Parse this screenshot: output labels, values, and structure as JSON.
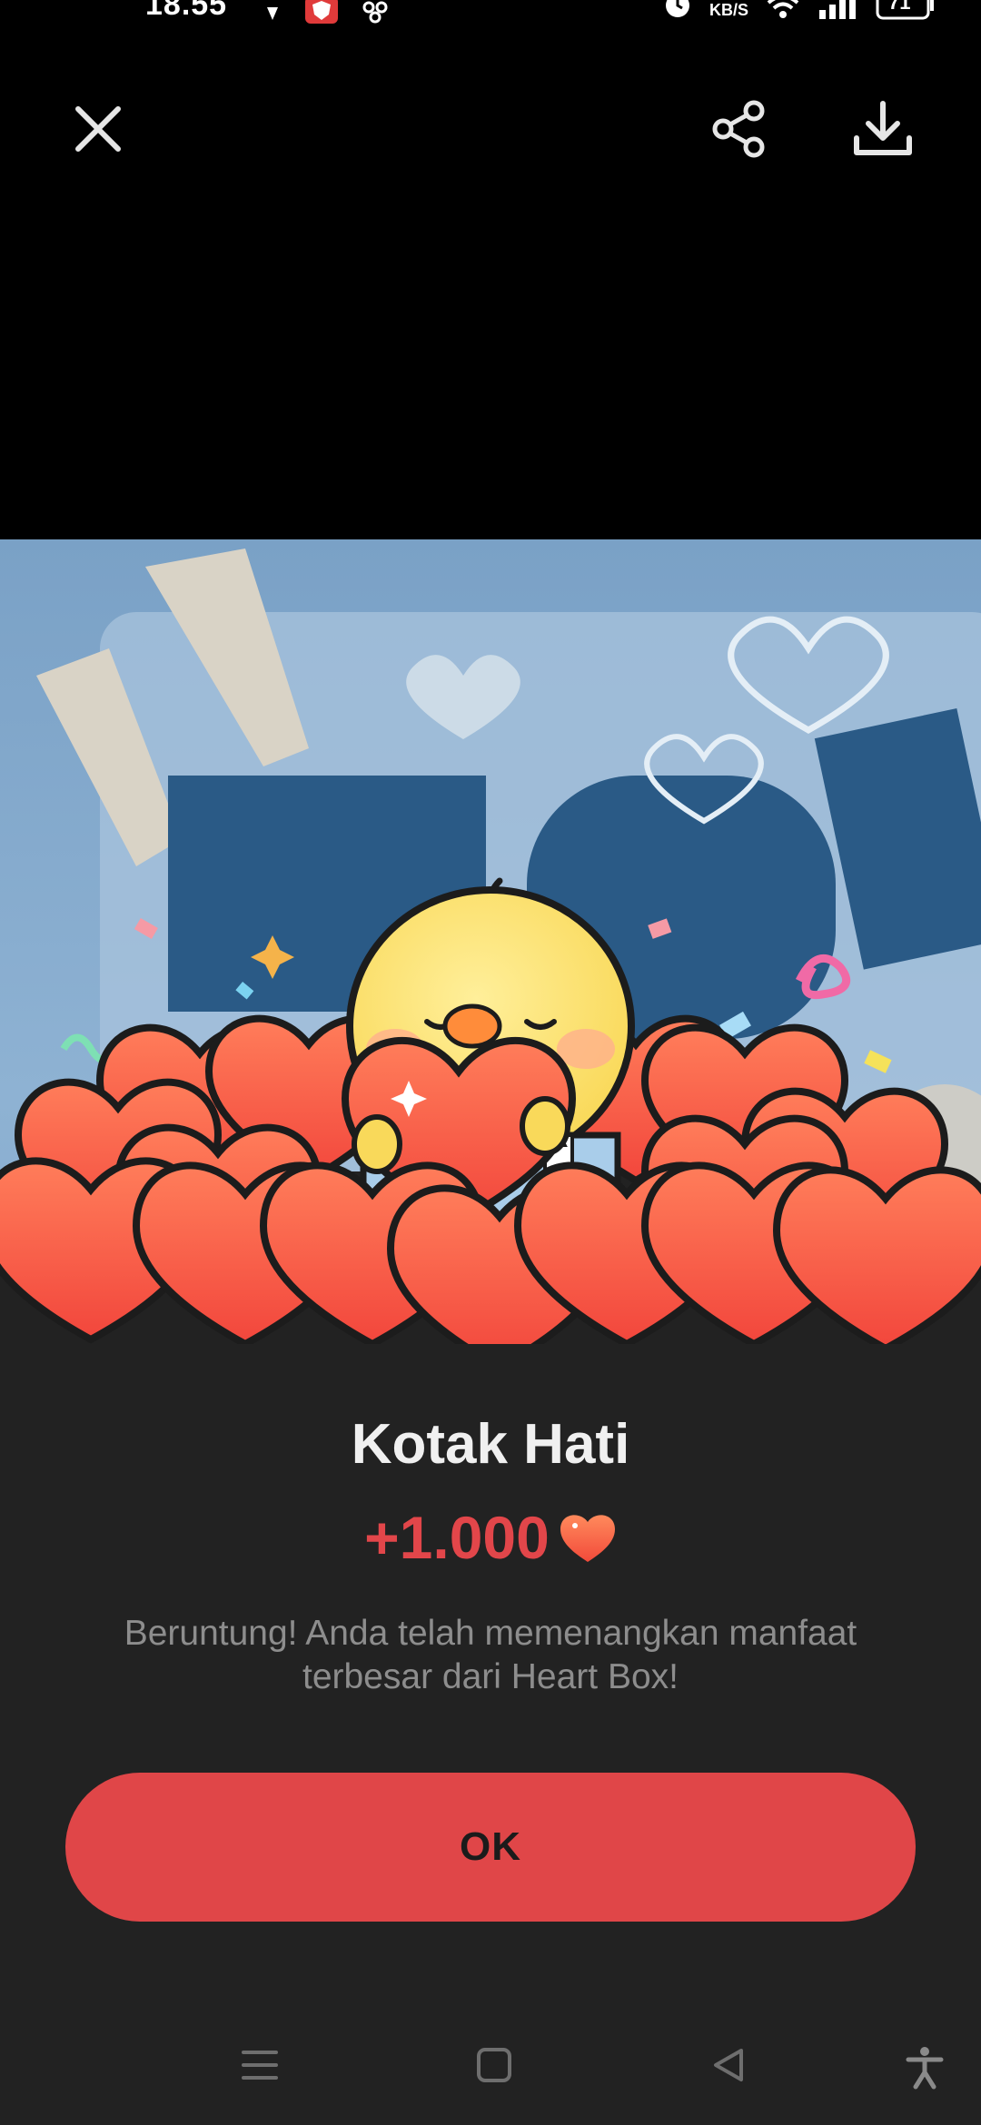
{
  "status_bar": {
    "time": "18.55",
    "network_speed_unit": "KB/S",
    "battery": "71"
  },
  "viewer": {
    "close_icon": "close-icon",
    "share_icon": "share-icon",
    "download_icon": "download-icon"
  },
  "dialog": {
    "title": "Kotak Hati",
    "reward_amount": "+1.000",
    "description": "Beruntung! Anda telah memenangkan manfaat terbesar dari Heart Box!",
    "ok_label": "OK"
  },
  "colors": {
    "accent": "#e04648",
    "sheet_bg": "#222222",
    "heart": "#f4653f"
  },
  "nav": {
    "menu_icon": "menu-icon",
    "home_icon": "home-square-icon",
    "back_icon": "back-triangle-icon",
    "accessibility_icon": "accessibility-icon"
  }
}
